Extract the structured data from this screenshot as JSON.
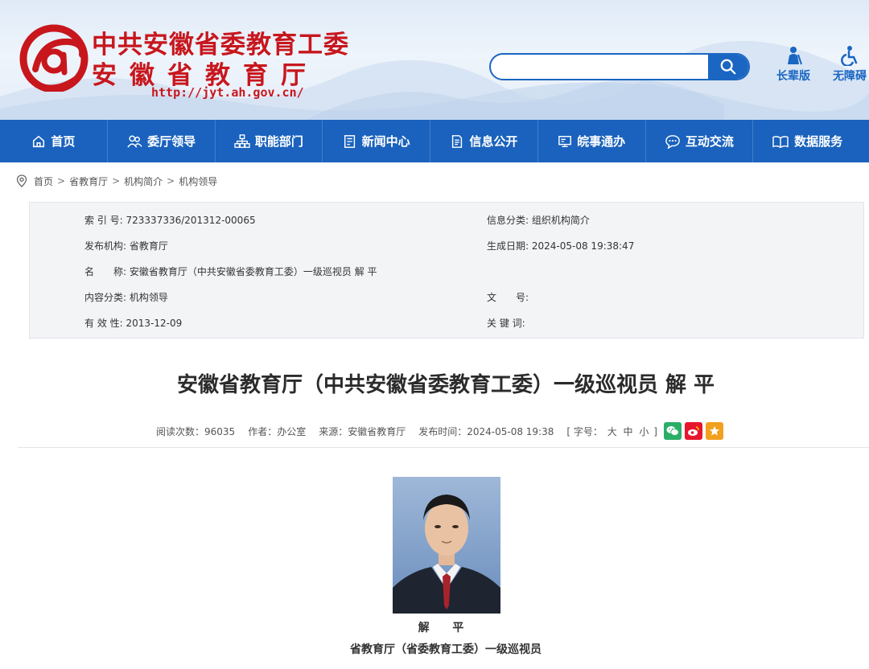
{
  "header": {
    "name_line1": "中共安徽省委教育工委",
    "name_line2": "安徽省教育厅",
    "url": "http://jyt.ah.gov.cn/",
    "search_placeholder": "",
    "tools": [
      {
        "label": "长辈版",
        "icon": "elder-icon"
      },
      {
        "label": "无障碍",
        "icon": "accessibility-icon"
      }
    ]
  },
  "nav": {
    "items": [
      {
        "label": "首页",
        "icon": "home-icon"
      },
      {
        "label": "委厅领导",
        "icon": "people-icon"
      },
      {
        "label": "职能部门",
        "icon": "org-chart-icon"
      },
      {
        "label": "新闻中心",
        "icon": "news-icon"
      },
      {
        "label": "信息公开",
        "icon": "document-icon"
      },
      {
        "label": "皖事通办",
        "icon": "monitor-icon"
      },
      {
        "label": "互动交流",
        "icon": "chat-icon"
      },
      {
        "label": "数据服务",
        "icon": "book-icon"
      }
    ]
  },
  "breadcrumb": {
    "items": [
      "首页",
      "省教育厅",
      "机构简介",
      "机构领导"
    ],
    "separator": ">"
  },
  "info": {
    "index_label": "索 引 号:",
    "index_value": "723337336/201312-00065",
    "category_label": "信息分类:",
    "category_value": "组织机构简介",
    "publisher_label": "发布机构:",
    "publisher_value": "省教育厅",
    "created_label": "生成日期:",
    "created_value": "2024-05-08 19:38:47",
    "name_label": "名　　称:",
    "name_value": "安徽省教育厅（中共安徽省委教育工委）一级巡视员 解 平",
    "content_cat_label": "内容分类:",
    "content_cat_value": "机构领导",
    "doc_no_label": "文　　号:",
    "doc_no_value": "",
    "validity_label": "有 效 性:",
    "validity_value": "2013-12-09",
    "keywords_label": "关 键 词:",
    "keywords_value": ""
  },
  "article": {
    "title": "安徽省教育厅（中共安徽省委教育工委）一级巡视员 解 平",
    "reads": "阅读次数：96035",
    "author": "作者：办公室",
    "source": "来源：安徽省教育厅",
    "published": "发布时间：2024-05-08 19:38",
    "font_size_prefix": "[ 字号：",
    "font_large": "大",
    "font_medium": "中",
    "font_small": "小",
    "font_size_suffix": "]",
    "person_name": "解 平",
    "person_title": "省教育厅（省委教育工委）一级巡视员"
  },
  "colors": {
    "brand_red": "#c8161d",
    "nav_blue": "#1a62bd",
    "wechat": "#2aae67",
    "weibo": "#e6162d",
    "favorite": "#f2a01f"
  }
}
